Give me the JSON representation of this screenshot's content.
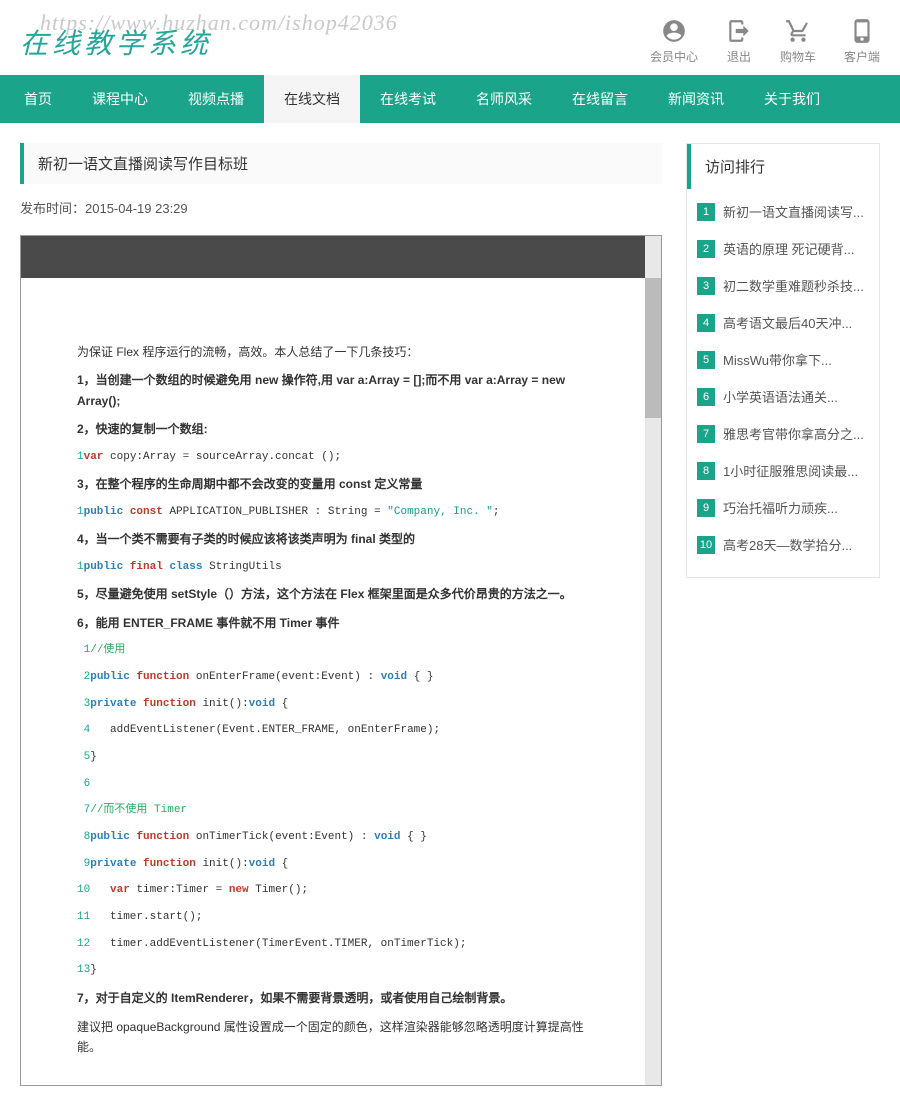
{
  "watermark": "https://www.huzhan.com/ishop42036",
  "logo": "在线教学系统",
  "top_icons": [
    {
      "name": "user-icon",
      "label": "会员中心"
    },
    {
      "name": "exit-icon",
      "label": "退出"
    },
    {
      "name": "cart-icon",
      "label": "购物车"
    },
    {
      "name": "phone-icon",
      "label": "客户端"
    }
  ],
  "nav": [
    {
      "label": "首页",
      "active": false
    },
    {
      "label": "课程中心",
      "active": false
    },
    {
      "label": "视频点播",
      "active": false
    },
    {
      "label": "在线文档",
      "active": true
    },
    {
      "label": "在线考试",
      "active": false
    },
    {
      "label": "名师风采",
      "active": false
    },
    {
      "label": "在线留言",
      "active": false
    },
    {
      "label": "新闻资讯",
      "active": false
    },
    {
      "label": "关于我们",
      "active": false
    }
  ],
  "article": {
    "title": "新初一语文直播阅读写作目标班",
    "pub_time_label": "发布时间：2015-04-19 23:29"
  },
  "doc": {
    "intro": "为保证 Flex 程序运行的流畅，高效。本人总结了一下几条技巧：",
    "h1": "1，当创建一个数组的时候避免用 new 操作符,用 var a:Array = [];而不用 var a:Array = new Array();",
    "h2": "2，快速的复制一个数组:",
    "code2_ln": "1",
    "code2_kw_var": "var",
    "code2_txt": " copy:Array = sourceArray.concat ();",
    "h3": "3，在整个程序的生命周期中都不会改变的变量用 const 定义常量",
    "code3_ln": "1",
    "code3": "public const APPLICATION_PUBLISHER : String = \"Company, Inc. \";",
    "h4": "4，当一个类不需要有子类的时候应该将该类声明为 final 类型的",
    "code4_ln": "1",
    "code4": "public final class StringUtils",
    "h5": "5，尽量避免使用 setStyle（）方法，这个方法在 Flex 框架里面是众多代价昂贵的方法之一。",
    "h6": "6，能用 ENTER_FRAME 事件就不用 Timer 事件",
    "code6": {
      "l1": {
        "ln": "1",
        "cm": "//使用"
      },
      "l2": {
        "ln": "2",
        "txt": "public function onEnterFrame(event:Event) : void { }"
      },
      "l3": {
        "ln": "3",
        "txt": "private function init():void {"
      },
      "l4": {
        "ln": "4",
        "txt": "   addEventListener(Event.ENTER_FRAME, onEnterFrame);"
      },
      "l5": {
        "ln": "5",
        "txt": "}"
      },
      "l6": {
        "ln": "6",
        "txt": ""
      },
      "l7": {
        "ln": "7",
        "cm": "//而不使用 Timer"
      },
      "l8": {
        "ln": "8",
        "txt": "public function onTimerTick(event:Event) : void { }"
      },
      "l9": {
        "ln": "9",
        "txt": "private function init():void {"
      },
      "l10": {
        "ln": "10",
        "txt": "   var timer:Timer = new Timer();"
      },
      "l11": {
        "ln": "11",
        "txt": "   timer.start();"
      },
      "l12": {
        "ln": "12",
        "txt": "   timer.addEventListener(TimerEvent.TIMER, onTimerTick);"
      },
      "l13": {
        "ln": "13",
        "txt": "}"
      }
    },
    "h7": "7，对于自定义的 ItemRenderer，如果不需要背景透明，或者使用自己绘制背景。",
    "p7": "建议把 opaqueBackground 属性设置成一个固定的颜色，这样渲染器能够忽略透明度计算提高性能。"
  },
  "sidebar": {
    "title": "访问排行",
    "items": [
      "新初一语文直播阅读写...",
      "英语的原理 死记硬背...",
      "初二数学重难题秒杀技...",
      "高考语文最后40天冲...",
      "MissWu带你拿下...",
      "小学英语语法通关...",
      "雅思考官带你拿高分之...",
      "1小时征服雅思阅读最...",
      "巧治托福听力顽疾...",
      "高考28天—数学拾分..."
    ]
  }
}
